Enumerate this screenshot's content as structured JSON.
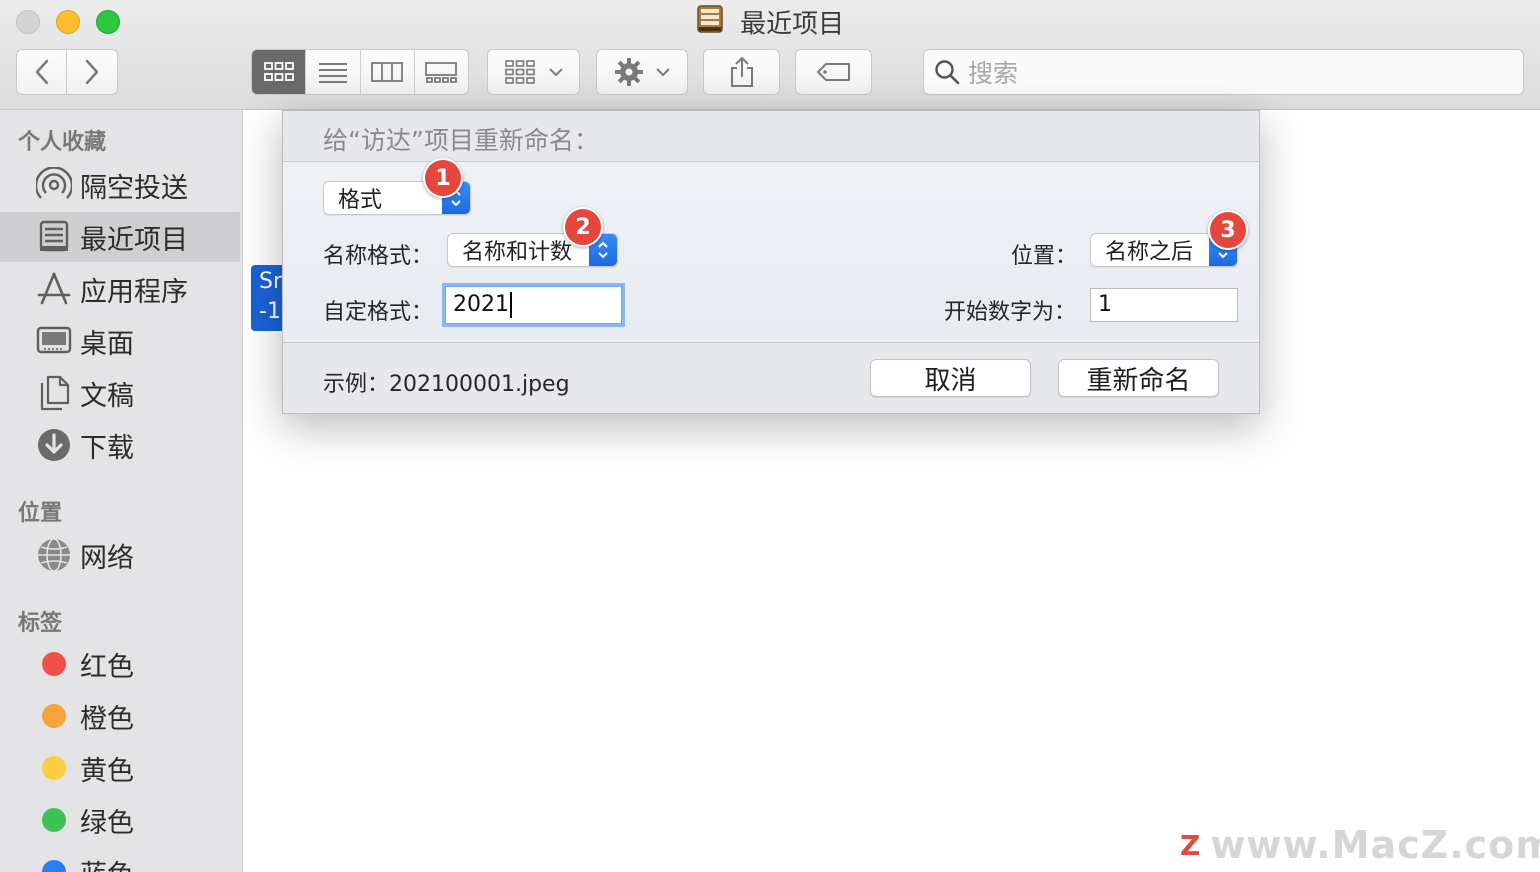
{
  "window": {
    "title": "最近项目"
  },
  "search": {
    "placeholder": "搜索"
  },
  "sidebar": {
    "favorites_header": "个人收藏",
    "favorites": [
      {
        "label": "隔空投送",
        "icon": "airdrop-icon"
      },
      {
        "label": "最近项目",
        "icon": "recents-icon",
        "selected": true
      },
      {
        "label": "应用程序",
        "icon": "applications-icon"
      },
      {
        "label": "桌面",
        "icon": "desktop-icon"
      },
      {
        "label": "文稿",
        "icon": "documents-icon"
      },
      {
        "label": "下载",
        "icon": "downloads-icon"
      }
    ],
    "locations_header": "位置",
    "locations": [
      {
        "label": "网络",
        "icon": "network-icon"
      }
    ],
    "tags_header": "标签",
    "tags": [
      {
        "label": "红色",
        "color": "#f0504a"
      },
      {
        "label": "橙色",
        "color": "#f6a33c"
      },
      {
        "label": "黄色",
        "color": "#f8cd3f"
      },
      {
        "label": "绿色",
        "color": "#3ec256"
      },
      {
        "label": "蓝色",
        "color": "#2a7ff0"
      }
    ]
  },
  "file_fragment": {
    "line1": "Sr",
    "line2": "-1"
  },
  "dialog": {
    "title": "给“访达”项目重新命名：",
    "mode_popup": "格式",
    "name_format_label": "名称格式：",
    "name_format_value": "名称和计数",
    "position_label": "位置：",
    "position_value": "名称之后",
    "custom_format_label": "自定格式：",
    "custom_format_value": "2021",
    "start_number_label": "开始数字为：",
    "start_number_value": "1",
    "example_label": "示例：",
    "example_value": "202100001.jpeg",
    "cancel_label": "取消",
    "rename_label": "重新命名"
  },
  "badges": [
    "1",
    "2",
    "3"
  ],
  "watermark": {
    "logo": "Z",
    "text": "www.MacZ.com"
  }
}
